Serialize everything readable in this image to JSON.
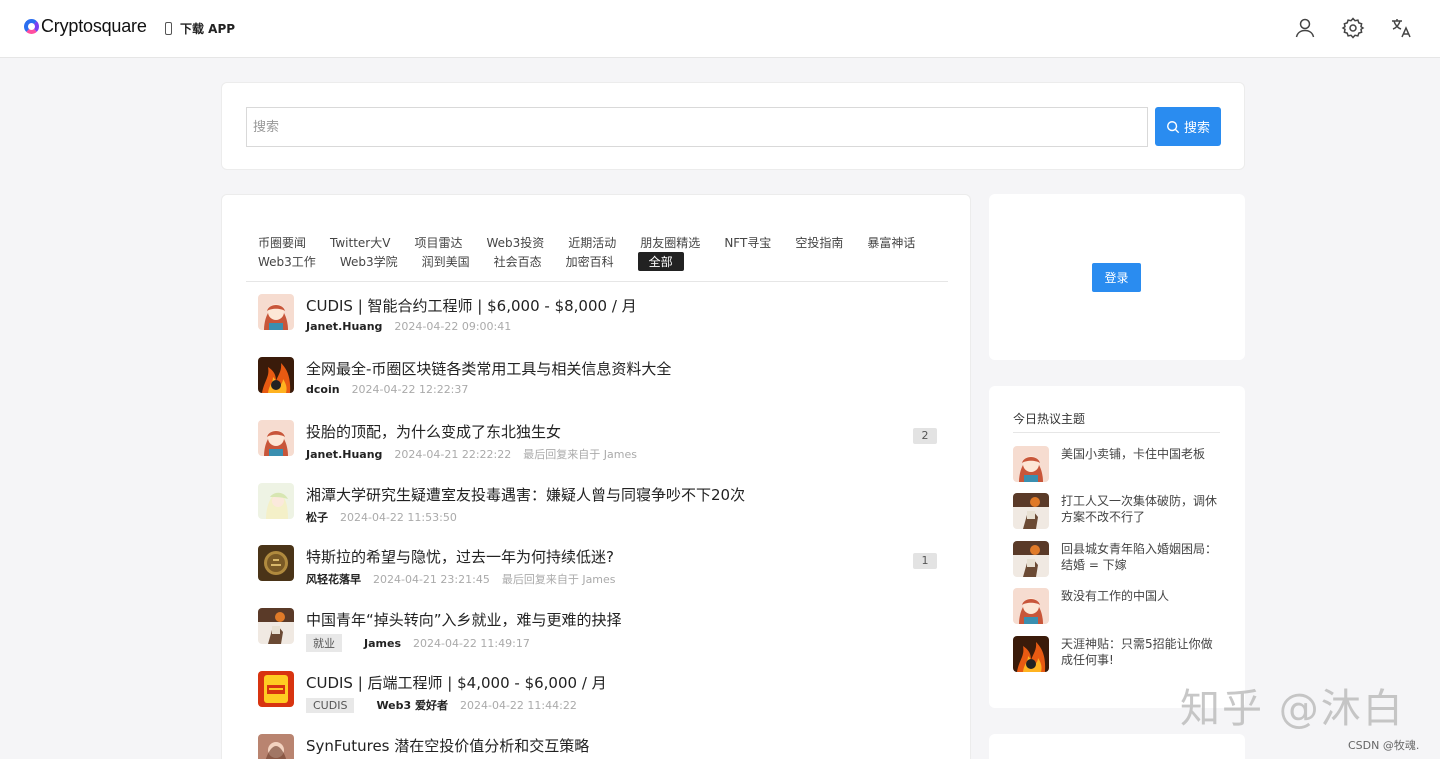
{
  "header": {
    "logo": "Cryptosquare",
    "download": "下载 APP",
    "icons": [
      "user-icon",
      "gear-icon",
      "translate-icon"
    ]
  },
  "search": {
    "placeholder": "搜索",
    "button": "搜索"
  },
  "tabs": {
    "row1": [
      "币圈要闻",
      "Twitter大V",
      "项目雷达",
      "Web3投资",
      "近期活动",
      "朋友圈精选",
      "NFT寻宝",
      "空投指南",
      "暴富神话"
    ],
    "row2": [
      "Web3工作",
      "Web3学院",
      "润到美国",
      "社会百态",
      "加密百科",
      "全部"
    ],
    "active": "全部"
  },
  "posts": [
    {
      "title": "CUDIS | 智能合约工程师 | $6,000 - $8,000 / 月",
      "author": "Janet.Huang",
      "time": "2024-04-22 09:00:41",
      "avatar": "girl-avatar"
    },
    {
      "title": "全网最全-币圈区块链各类常用工具与相关信息资料大全",
      "author": "dcoin",
      "time": "2024-04-22 12:22:37",
      "avatar": "fire-avatar"
    },
    {
      "title": "投胎的顶配，为什么变成了东北独生女",
      "author": "Janet.Huang",
      "time": "2024-04-21 22:22:22",
      "reply": "最后回复来自于 James",
      "count": "2",
      "avatar": "girl-avatar"
    },
    {
      "title": "湘潭大学研究生疑遭室友投毒遇害：嫌疑人曾与同寝争吵不下20次",
      "author": "松子",
      "time": "2024-04-22 11:53:50",
      "avatar": "anime-avatar"
    },
    {
      "title": "特斯拉的希望与隐忧，过去一年为何持续低迷?",
      "author": "风轻花落早",
      "time": "2024-04-21 23:21:45",
      "reply": "最后回复来自于 James",
      "count": "1",
      "avatar": "coin-avatar"
    },
    {
      "title": "中国青年“掉头转向”入乡就业，难与更难的抉择",
      "tag": "就业",
      "author": "James",
      "time": "2024-04-22 11:49:17",
      "avatar": "basketball-avatar"
    },
    {
      "title": "CUDIS | 后端工程师 | $4,000 - $6,000 / 月",
      "tag": "CUDIS",
      "author": "Web3 爱好者",
      "time": "2024-04-22 11:44:22",
      "avatar": "poker-avatar"
    },
    {
      "title": "SynFutures 潜在空投价值分析和交互策略",
      "author": "",
      "time": "",
      "avatar": "portrait-avatar"
    }
  ],
  "login": {
    "button": "登录"
  },
  "hot": {
    "title": "今日热议主题",
    "items": [
      {
        "text": "美国小卖铺，卡住中国老板",
        "avatar": "girl-avatar"
      },
      {
        "text": "打工人又一次集体破防，调休方案不改不行了",
        "avatar": "basketball-avatar"
      },
      {
        "text": "回县城女青年陷入婚姻困局：结婚 = 下嫁",
        "avatar": "basketball-avatar"
      },
      {
        "text": "致没有工作的中国人",
        "avatar": "girl-avatar"
      },
      {
        "text": "天涯神贴：只需5招能让你做成任何事!",
        "avatar": "fire-avatar"
      }
    ]
  },
  "watermark": "知乎 @沐白",
  "csdn": "CSDN @牧魂."
}
